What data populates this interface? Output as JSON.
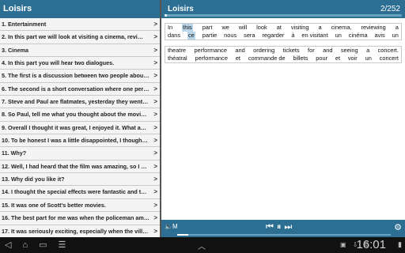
{
  "left": {
    "title": "Loisirs",
    "items": [
      "1. Entertainment",
      "2. In this part we will look at visiting a cinema, revi…",
      "3. Cinema",
      "4. In this part you will hear two dialogues.",
      "5. The first is a discussion between two people abou…",
      "6. The second is a short conversation where one per…",
      "7. Steve and Paul are flatmates, yesterday they went…",
      "8. So Paul, tell me what you thought about the movi…",
      "9. Overall I thought it was great, I enjoyed it. What a…",
      "10. To be honest I was a little disappointed, I though…",
      "11. Why?",
      "12. Well, I had heard that the film was amazing, so I …",
      "13. Why did you like it?",
      "14. I thought the special effects were fantastic and t…",
      "15. It was one of Scott's better movies.",
      "16. The best part for me was when the policeman am…",
      "17. It was seriously exciting, especially when the vill…"
    ]
  },
  "right": {
    "title": "Loisirs",
    "page": "2/252",
    "block1": {
      "row1": [
        "In",
        "this",
        "part",
        "we",
        "will",
        "look",
        "at",
        "visiting",
        "a",
        "cinema,",
        "reviewing",
        "a"
      ],
      "row2": [
        "dans",
        "ce",
        "partie",
        "nous",
        "sera",
        "regarder",
        "à",
        "en visitant",
        "un",
        "cinéma",
        "avis",
        "un"
      ],
      "highlight_index": 1
    },
    "block2": {
      "row1": [
        "theatre",
        "performance",
        "and",
        "ordering",
        "tickets",
        "for",
        "and",
        "seeing",
        "a",
        "concert."
      ],
      "row2": [
        "théatral",
        "performance",
        "et",
        "commande de",
        "billets",
        "pour",
        "et",
        "voir",
        "un",
        "concert"
      ]
    },
    "volume_label": "M"
  },
  "player": {
    "controls": [
      "prev",
      "pause",
      "next"
    ],
    "progress_fraction": 0.05
  },
  "system": {
    "time": "16:01"
  }
}
